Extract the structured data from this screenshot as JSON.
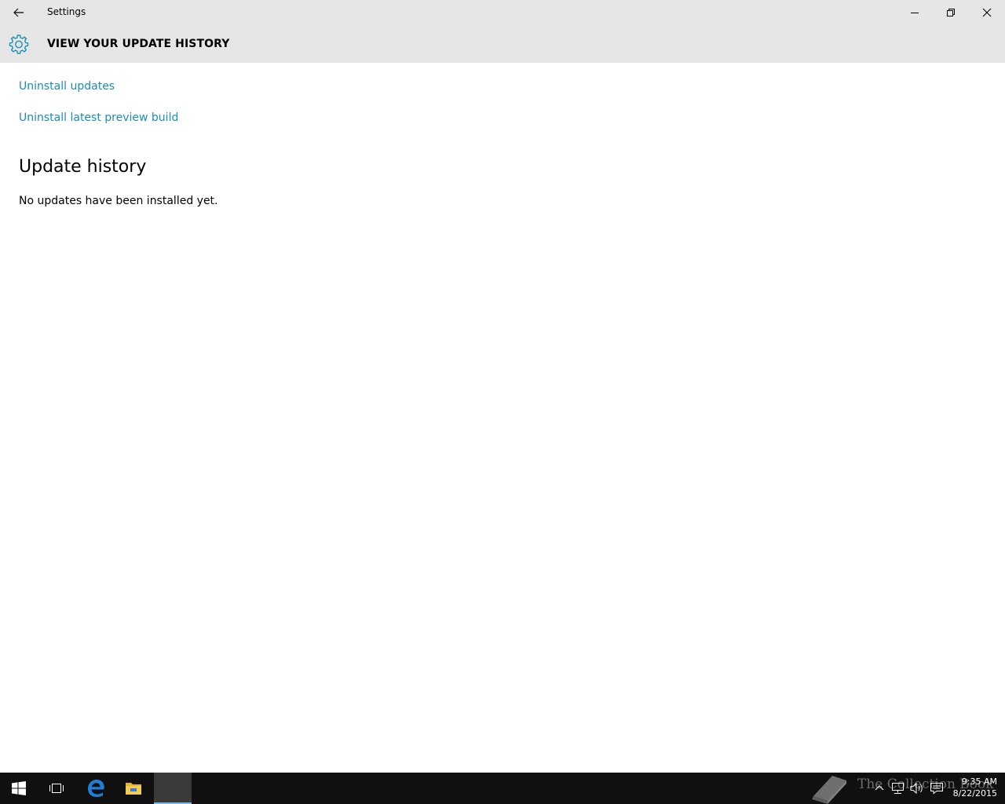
{
  "window": {
    "title": "Settings"
  },
  "header": {
    "page_title": "VIEW YOUR UPDATE HISTORY"
  },
  "links": {
    "uninstall_updates": "Uninstall updates",
    "uninstall_preview": "Uninstall latest preview build"
  },
  "history": {
    "heading": "Update history",
    "status": "No updates have been installed yet."
  },
  "taskbar": {
    "watermark": "The Collection Book",
    "time": "9:35 AM",
    "date": "8/22/2015"
  },
  "colors": {
    "accent": "#1a8fb5",
    "chrome": "#e6e6e6",
    "taskbar": "#101010"
  },
  "icons": {
    "back": "arrow-left-icon",
    "gear": "gear-icon",
    "minimize": "minimize-icon",
    "maximize": "restore-icon",
    "close": "close-icon",
    "start": "windows-start-icon",
    "task_view": "task-view-icon",
    "edge": "edge-browser-icon",
    "explorer": "file-explorer-icon",
    "tray": [
      "chevron-up-icon",
      "network-icon",
      "volume-icon",
      "action-center-icon"
    ]
  }
}
